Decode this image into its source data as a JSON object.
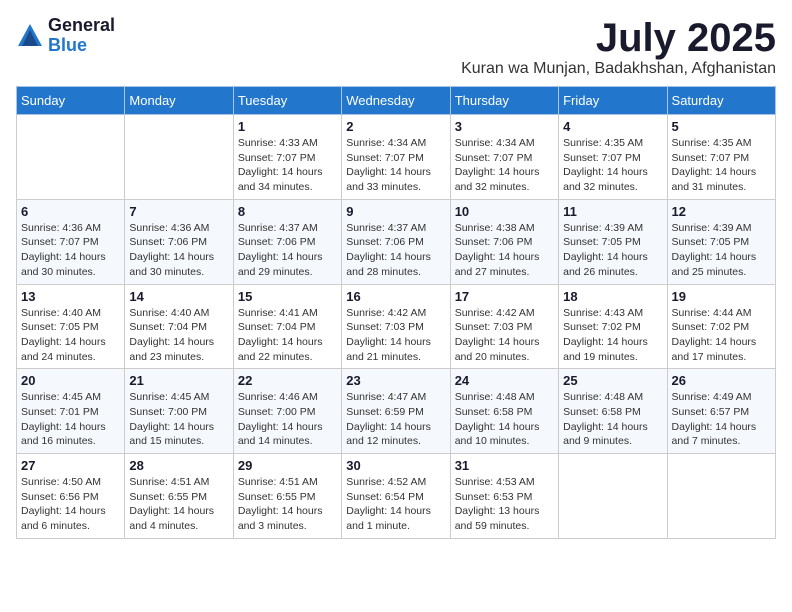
{
  "logo": {
    "general": "General",
    "blue": "Blue"
  },
  "title": {
    "month": "July 2025",
    "location": "Kuran wa Munjan, Badakhshan, Afghanistan"
  },
  "weekdays": [
    "Sunday",
    "Monday",
    "Tuesday",
    "Wednesday",
    "Thursday",
    "Friday",
    "Saturday"
  ],
  "weeks": [
    [
      {
        "day": "",
        "info": ""
      },
      {
        "day": "",
        "info": ""
      },
      {
        "day": "1",
        "info": "Sunrise: 4:33 AM\nSunset: 7:07 PM\nDaylight: 14 hours\nand 34 minutes."
      },
      {
        "day": "2",
        "info": "Sunrise: 4:34 AM\nSunset: 7:07 PM\nDaylight: 14 hours\nand 33 minutes."
      },
      {
        "day": "3",
        "info": "Sunrise: 4:34 AM\nSunset: 7:07 PM\nDaylight: 14 hours\nand 32 minutes."
      },
      {
        "day": "4",
        "info": "Sunrise: 4:35 AM\nSunset: 7:07 PM\nDaylight: 14 hours\nand 32 minutes."
      },
      {
        "day": "5",
        "info": "Sunrise: 4:35 AM\nSunset: 7:07 PM\nDaylight: 14 hours\nand 31 minutes."
      }
    ],
    [
      {
        "day": "6",
        "info": "Sunrise: 4:36 AM\nSunset: 7:07 PM\nDaylight: 14 hours\nand 30 minutes."
      },
      {
        "day": "7",
        "info": "Sunrise: 4:36 AM\nSunset: 7:06 PM\nDaylight: 14 hours\nand 30 minutes."
      },
      {
        "day": "8",
        "info": "Sunrise: 4:37 AM\nSunset: 7:06 PM\nDaylight: 14 hours\nand 29 minutes."
      },
      {
        "day": "9",
        "info": "Sunrise: 4:37 AM\nSunset: 7:06 PM\nDaylight: 14 hours\nand 28 minutes."
      },
      {
        "day": "10",
        "info": "Sunrise: 4:38 AM\nSunset: 7:06 PM\nDaylight: 14 hours\nand 27 minutes."
      },
      {
        "day": "11",
        "info": "Sunrise: 4:39 AM\nSunset: 7:05 PM\nDaylight: 14 hours\nand 26 minutes."
      },
      {
        "day": "12",
        "info": "Sunrise: 4:39 AM\nSunset: 7:05 PM\nDaylight: 14 hours\nand 25 minutes."
      }
    ],
    [
      {
        "day": "13",
        "info": "Sunrise: 4:40 AM\nSunset: 7:05 PM\nDaylight: 14 hours\nand 24 minutes."
      },
      {
        "day": "14",
        "info": "Sunrise: 4:40 AM\nSunset: 7:04 PM\nDaylight: 14 hours\nand 23 minutes."
      },
      {
        "day": "15",
        "info": "Sunrise: 4:41 AM\nSunset: 7:04 PM\nDaylight: 14 hours\nand 22 minutes."
      },
      {
        "day": "16",
        "info": "Sunrise: 4:42 AM\nSunset: 7:03 PM\nDaylight: 14 hours\nand 21 minutes."
      },
      {
        "day": "17",
        "info": "Sunrise: 4:42 AM\nSunset: 7:03 PM\nDaylight: 14 hours\nand 20 minutes."
      },
      {
        "day": "18",
        "info": "Sunrise: 4:43 AM\nSunset: 7:02 PM\nDaylight: 14 hours\nand 19 minutes."
      },
      {
        "day": "19",
        "info": "Sunrise: 4:44 AM\nSunset: 7:02 PM\nDaylight: 14 hours\nand 17 minutes."
      }
    ],
    [
      {
        "day": "20",
        "info": "Sunrise: 4:45 AM\nSunset: 7:01 PM\nDaylight: 14 hours\nand 16 minutes."
      },
      {
        "day": "21",
        "info": "Sunrise: 4:45 AM\nSunset: 7:00 PM\nDaylight: 14 hours\nand 15 minutes."
      },
      {
        "day": "22",
        "info": "Sunrise: 4:46 AM\nSunset: 7:00 PM\nDaylight: 14 hours\nand 14 minutes."
      },
      {
        "day": "23",
        "info": "Sunrise: 4:47 AM\nSunset: 6:59 PM\nDaylight: 14 hours\nand 12 minutes."
      },
      {
        "day": "24",
        "info": "Sunrise: 4:48 AM\nSunset: 6:58 PM\nDaylight: 14 hours\nand 10 minutes."
      },
      {
        "day": "25",
        "info": "Sunrise: 4:48 AM\nSunset: 6:58 PM\nDaylight: 14 hours\nand 9 minutes."
      },
      {
        "day": "26",
        "info": "Sunrise: 4:49 AM\nSunset: 6:57 PM\nDaylight: 14 hours\nand 7 minutes."
      }
    ],
    [
      {
        "day": "27",
        "info": "Sunrise: 4:50 AM\nSunset: 6:56 PM\nDaylight: 14 hours\nand 6 minutes."
      },
      {
        "day": "28",
        "info": "Sunrise: 4:51 AM\nSunset: 6:55 PM\nDaylight: 14 hours\nand 4 minutes."
      },
      {
        "day": "29",
        "info": "Sunrise: 4:51 AM\nSunset: 6:55 PM\nDaylight: 14 hours\nand 3 minutes."
      },
      {
        "day": "30",
        "info": "Sunrise: 4:52 AM\nSunset: 6:54 PM\nDaylight: 14 hours\nand 1 minute."
      },
      {
        "day": "31",
        "info": "Sunrise: 4:53 AM\nSunset: 6:53 PM\nDaylight: 13 hours\nand 59 minutes."
      },
      {
        "day": "",
        "info": ""
      },
      {
        "day": "",
        "info": ""
      }
    ]
  ]
}
